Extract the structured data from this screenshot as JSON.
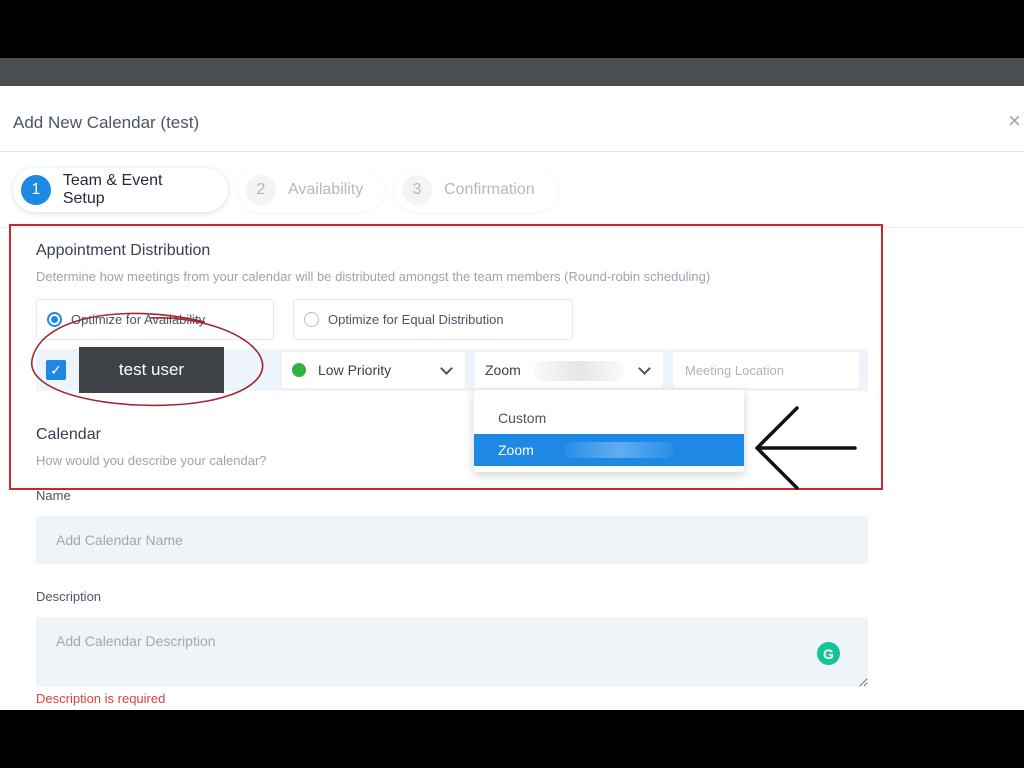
{
  "modal": {
    "title": "Add New Calendar (test)",
    "close_icon": "close-icon",
    "close_symbol": "×"
  },
  "steps": [
    {
      "number": "1",
      "label": "Team & Event Setup",
      "state": "active"
    },
    {
      "number": "2",
      "label": "Availability",
      "state": "inactive"
    },
    {
      "number": "3",
      "label": "Confirmation",
      "state": "inactive"
    }
  ],
  "appointment_distribution": {
    "title": "Appointment Distribution",
    "subtitle": "Determine how meetings from your calendar will be distributed amongst the team members (Round-robin scheduling)",
    "options": [
      {
        "label": "Optimize for Availability",
        "checked": true
      },
      {
        "label": "Optimize for Equal Distribution",
        "checked": false
      }
    ]
  },
  "team_member": {
    "checked": true,
    "check_symbol": "✓",
    "name": "test user",
    "priority": "Low Priority",
    "priority_color": "#2fb344",
    "meeting_type": "Zoom",
    "location_placeholder": "Meeting Location"
  },
  "meeting_dropdown": {
    "options": [
      {
        "label": "Custom",
        "selected": false
      },
      {
        "label": "Zoom",
        "selected": true
      }
    ]
  },
  "calendar": {
    "title": "Calendar",
    "subtitle": "How would you describe your calendar?",
    "name_label": "Name",
    "name_placeholder": "Add Calendar Name",
    "description_label": "Description",
    "description_placeholder": "Add Calendar Description",
    "error": "Description is required"
  },
  "grammarly": {
    "icon": "grammarly-icon",
    "glyph": "G"
  },
  "colors": {
    "accent": "#1e88e5",
    "annotation_red": "#c8282e",
    "annotation_circle": "#9e2a33",
    "error": "#d9413a"
  }
}
